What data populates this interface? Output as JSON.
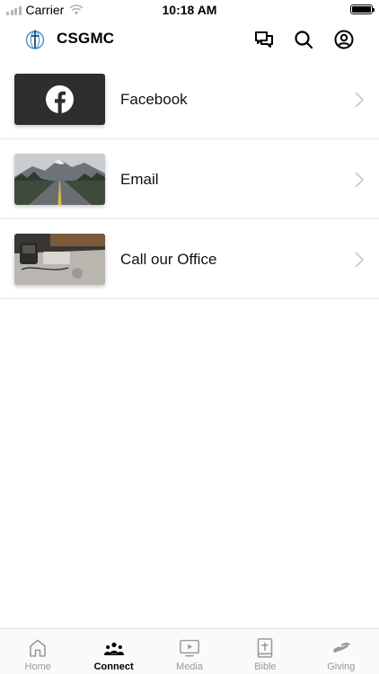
{
  "status_bar": {
    "carrier": "Carrier",
    "time": "10:18 AM"
  },
  "header": {
    "title": "CSGMC",
    "logo_icon": "globe-cross-icon",
    "actions": [
      "chat-icon",
      "search-icon",
      "account-icon"
    ]
  },
  "list": {
    "items": [
      {
        "label": "Facebook",
        "thumb": "facebook-logo"
      },
      {
        "label": "Email",
        "thumb": "mountain-road-photo"
      },
      {
        "label": "Call our Office",
        "thumb": "office-desk-photo"
      }
    ]
  },
  "tabs": [
    {
      "label": "Home",
      "icon": "home-icon",
      "active": false
    },
    {
      "label": "Connect",
      "icon": "people-icon",
      "active": true
    },
    {
      "label": "Media",
      "icon": "media-icon",
      "active": false
    },
    {
      "label": "Bible",
      "icon": "bible-icon",
      "active": false
    },
    {
      "label": "Giving",
      "icon": "giving-icon",
      "active": false
    }
  ],
  "colors": {
    "accent": "#4a90c8",
    "divider": "#e6e6e6",
    "inactive_tab": "#9a9a9a",
    "facebook_thumb_bg": "#2e2e2e"
  }
}
